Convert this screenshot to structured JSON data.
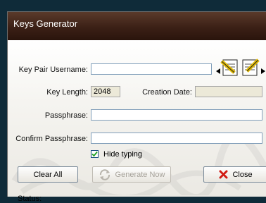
{
  "window": {
    "title": "Keys Generator"
  },
  "form": {
    "username_label": "Key Pair Username:",
    "username_value": "",
    "key_length_label": "Key Length:",
    "key_length_value": "2048",
    "creation_date_label": "Creation Date:",
    "creation_date_value": "",
    "passphrase_label": "Passphrase:",
    "passphrase_value": "",
    "confirm_label": "Confirm Passphrase:",
    "confirm_value": "",
    "hide_typing_label": "Hide typing",
    "hide_typing_checked": true
  },
  "buttons": {
    "clear_all": "Clear All",
    "generate_now": "Generate Now",
    "close": "Close"
  },
  "status": {
    "label": "Status:"
  },
  "icons": [
    "import-keys-icon",
    "export-keys-icon",
    "refresh-icon",
    "close-x-icon"
  ],
  "colors": {
    "title_bar": "#3b2016",
    "close_x": "#d11a12"
  }
}
